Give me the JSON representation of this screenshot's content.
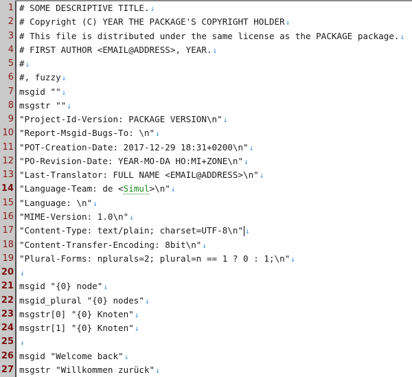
{
  "editor": {
    "eol_marker": "↓",
    "colors": {
      "gutter_bg": "#c9c9c9",
      "line_number": "#8b1a1a",
      "eol_marker": "#3d8fe0",
      "spellcheck": "#1a8a1a"
    },
    "lines": [
      {
        "n": "1",
        "text": "# SOME DESCRIPTIVE TITLE."
      },
      {
        "n": "2",
        "text": "# Copyright (C) YEAR THE PACKAGE'S COPYRIGHT HOLDER"
      },
      {
        "n": "3",
        "text": "# This file is distributed under the same license as the PACKAGE package."
      },
      {
        "n": "4",
        "text": "# FIRST AUTHOR <EMAIL@ADDRESS>, YEAR."
      },
      {
        "n": "5",
        "text": "#"
      },
      {
        "n": "6",
        "text": "#, fuzzy"
      },
      {
        "n": "7",
        "text": "msgid \"\""
      },
      {
        "n": "8",
        "text": "msgstr \"\""
      },
      {
        "n": "9",
        "text": "\"Project-Id-Version: PACKAGE VERSION\\n\""
      },
      {
        "n": "10",
        "text": "\"Report-Msgid-Bugs-To: \\n\""
      },
      {
        "n": "11",
        "text": "\"POT-Creation-Date: 2017-12-29 18:31+0200\\n\""
      },
      {
        "n": "12",
        "text": "\"PO-Revision-Date: YEAR-MO-DA HO:MI+ZONE\\n\""
      },
      {
        "n": "13",
        "text": "\"Last-Translator: FULL NAME <EMAIL@ADDRESS>\\n\""
      },
      {
        "n": "14",
        "pre": "\"Language-Team: de <",
        "spell": "Simul",
        "post": ">\\n\""
      },
      {
        "n": "15",
        "text": "\"Language: \\n\""
      },
      {
        "n": "16",
        "text": "\"MIME-Version: 1.0\\n\""
      },
      {
        "n": "17",
        "text": "\"Content-Type: text/plain; charset=UTF-8\\n\""
      },
      {
        "n": "18",
        "text": "\"Content-Transfer-Encoding: 8bit\\n\""
      },
      {
        "n": "19",
        "text": "\"Plural-Forms: nplurals=2; plural=n == 1 ? 0 : 1;\\n\""
      },
      {
        "n": "20",
        "text": ""
      },
      {
        "n": "21",
        "text": "msgid \"{0} node\""
      },
      {
        "n": "22",
        "text": "msgid_plural \"{0} nodes\""
      },
      {
        "n": "23",
        "text": "msgstr[0] \"{0} Knoten\""
      },
      {
        "n": "24",
        "text": "msgstr[1] \"{0} Knoten\""
      },
      {
        "n": "25",
        "text": ""
      },
      {
        "n": "26",
        "text": "msgid \"Welcome back\""
      },
      {
        "n": "27",
        "text": "msgstr \"Willkommen zurück\""
      }
    ]
  }
}
